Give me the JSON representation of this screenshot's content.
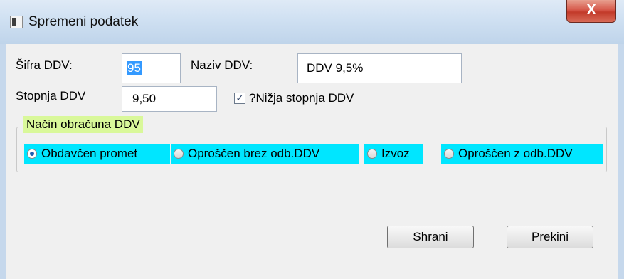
{
  "window": {
    "title": "Spremeni podatek",
    "close_glyph": "X"
  },
  "form": {
    "sifra_label": "Šifra DDV:",
    "sifra_value": "95",
    "naziv_label": "Naziv DDV:",
    "naziv_value": "DDV 9,5%",
    "stopnja_label": "Stopnja DDV",
    "stopnja_value": "9,50",
    "nizja_checked": true,
    "nizja_label": "?Nižja stopnja DDV"
  },
  "group": {
    "legend": "Način obračuna DDV",
    "options": [
      {
        "label": "Obdavčen promet",
        "selected": true
      },
      {
        "label": "Oproščen brez odb.DDV",
        "selected": false
      },
      {
        "label": "Izvoz",
        "selected": false
      },
      {
        "label": "Oproščen z odb.DDV",
        "selected": false
      }
    ]
  },
  "buttons": {
    "save": "Shrani",
    "cancel": "Prekini"
  }
}
